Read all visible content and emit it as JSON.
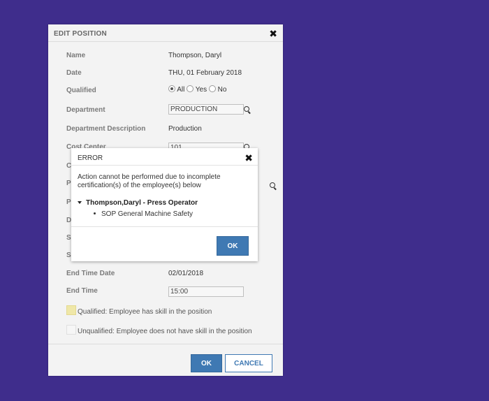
{
  "colors": {
    "background": "#3f2d8c",
    "primary": "#3f79b3",
    "qualified": "#efe7a8",
    "unqualified": "#f6f6f6"
  },
  "panel": {
    "title": "EDIT POSITION",
    "fields": {
      "name": {
        "label": "Name",
        "value": "Thompson, Daryl"
      },
      "date": {
        "label": "Date",
        "value": "THU, 01 February 2018"
      },
      "qualified": {
        "label": "Qualified",
        "options": [
          "All",
          "Yes",
          "No"
        ],
        "selected": "All"
      },
      "department": {
        "label": "Department",
        "value": "PRODUCTION"
      },
      "department_description": {
        "label": "Department Description",
        "value": "Production"
      },
      "cost_center": {
        "label": "Cost Center",
        "value": "101"
      },
      "hidden_rows": [
        "C",
        "P",
        "P",
        "D",
        "S",
        "S"
      ],
      "end_time_date": {
        "label": "End Time Date",
        "value": "02/01/2018"
      },
      "end_time": {
        "label": "End Time",
        "value": "15:00"
      }
    },
    "legend": {
      "qualified": "Qualified: Employee has skill in the position",
      "unqualified": "Unqualified: Employee does not have skill in the position"
    },
    "ok_label": "OK",
    "cancel_label": "CANCEL"
  },
  "dialog": {
    "title": "ERROR",
    "message": "Action cannot be performed due to incomplete certification(s) of the employee(s) below",
    "employee": "Thompson,Daryl - Press Operator",
    "certification": "SOP General Machine Safety",
    "ok_label": "OK"
  }
}
